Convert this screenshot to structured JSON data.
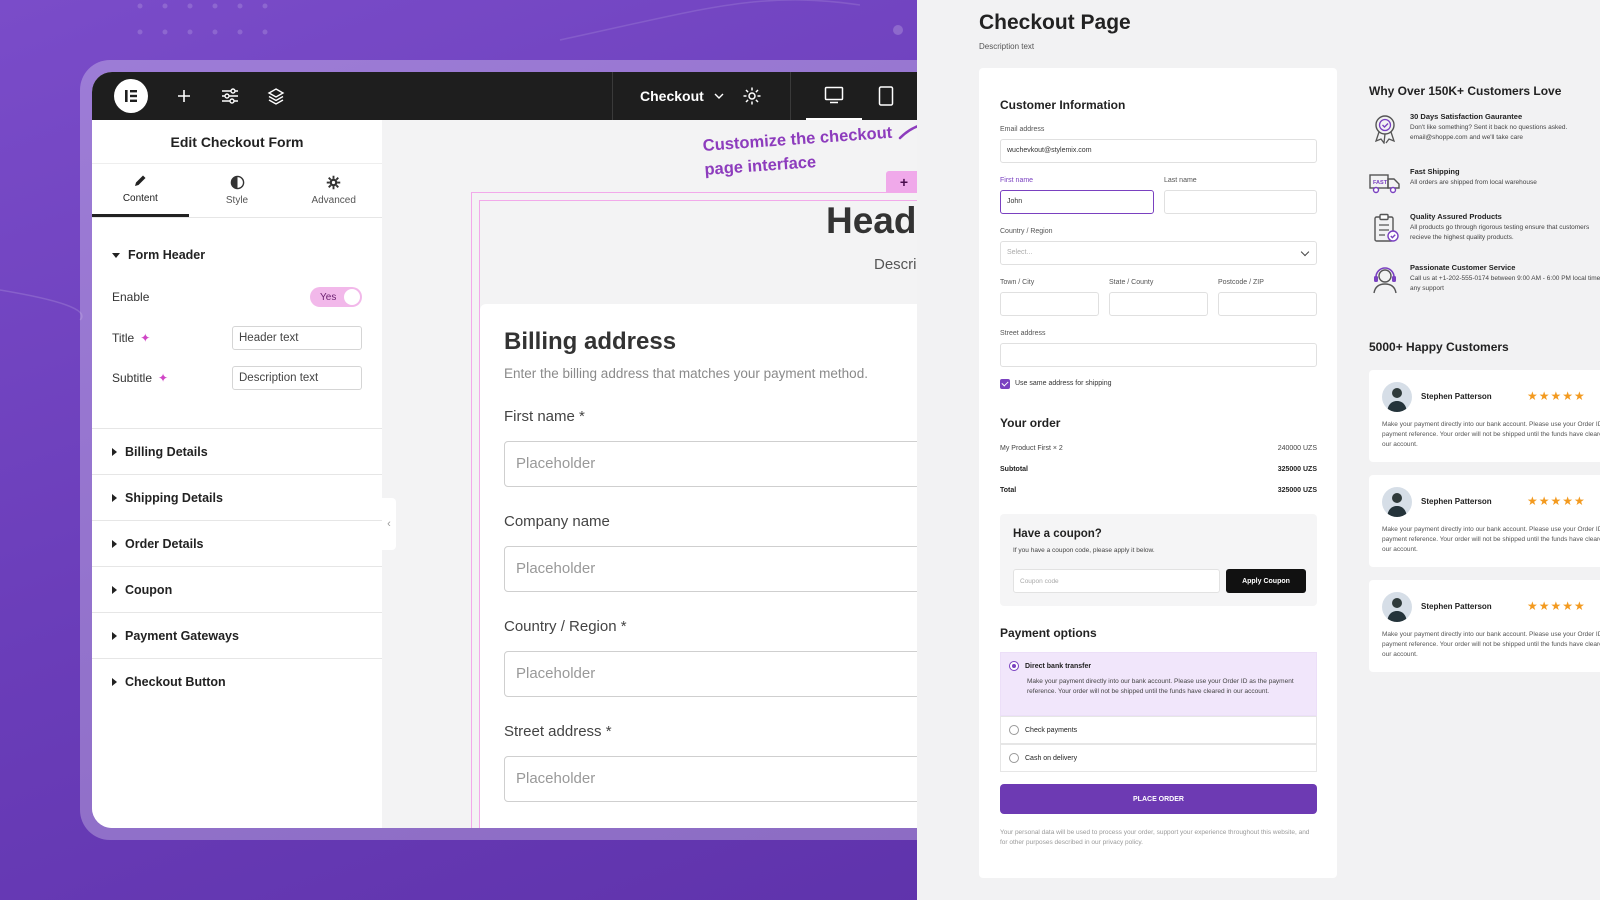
{
  "editor": {
    "toolbar": {
      "page_name": "Checkout"
    },
    "panel": {
      "title": "Edit Checkout Form",
      "tabs": [
        {
          "label": "Content",
          "icon": "pencil-icon"
        },
        {
          "label": "Style",
          "icon": "half-circle-icon"
        },
        {
          "label": "Advanced",
          "icon": "gear-icon"
        }
      ],
      "form_header": {
        "label": "Form Header",
        "enable_label": "Enable",
        "enable_value": "Yes",
        "title_label": "Title",
        "title_value": "Header text",
        "subtitle_label": "Subtitle",
        "subtitle_value": "Description text"
      },
      "sections": [
        "Billing Details",
        "Shipping Details",
        "Order Details",
        "Coupon",
        "Payment Gateways",
        "Checkout Button"
      ]
    },
    "canvas": {
      "callout_line1": "Customize the checkout",
      "callout_line2": "page interface",
      "plus": "+",
      "header_text": "Head",
      "desc_text": "Descri",
      "billing": {
        "title": "Billing address",
        "subtitle": "Enter the billing address that matches your payment method.",
        "fields": [
          {
            "label": "First name *",
            "placeholder": "Placeholder"
          },
          {
            "label": "Company name",
            "placeholder": "Placeholder"
          },
          {
            "label": "Country / Region *",
            "placeholder": "Placeholder"
          },
          {
            "label": "Street address *",
            "placeholder": "Placeholder"
          }
        ]
      }
    }
  },
  "checkout": {
    "title": "Checkout Page",
    "description": "Description text",
    "customer": {
      "heading": "Customer Information",
      "email_label": "Email address",
      "email_value": "wuchevkout@stylemix.com",
      "first_label": "First name",
      "first_value": "John",
      "last_label": "Last name",
      "country_label": "Country / Region",
      "country_placeholder": "Select...",
      "town_label": "Town / City",
      "state_label": "State / County",
      "postcode_label": "Postcode / ZIP",
      "street_label": "Street address",
      "same_address_label": "Use same address for shipping"
    },
    "order": {
      "heading": "Your order",
      "item_name": "My Product First  × 2",
      "item_price": "240000 UZS",
      "subtotal_label": "Subtotal",
      "subtotal_value": "325000 UZS",
      "total_label": "Total",
      "total_value": "325000 UZS"
    },
    "coupon": {
      "title": "Have a coupon?",
      "text": "If you have a coupon code, please apply it below.",
      "placeholder": "Coupon code",
      "button": "Apply Coupon"
    },
    "payment": {
      "heading": "Payment options",
      "options": [
        {
          "label": "Direct bank transfer",
          "selected": true,
          "description": "Make your payment directly into our bank account. Please use your Order ID as the payment reference. Your order will not be shipped until the funds have cleared in our account."
        },
        {
          "label": "Check payments",
          "selected": false
        },
        {
          "label": "Cash on delivery",
          "selected": false
        }
      ],
      "place_order": "PLACE ORDER",
      "privacy": "Your personal data will be used to process your order, support your experience throughout this website, and for other purposes described in our privacy policy."
    },
    "why": {
      "heading": "Why Over 150K+ Customers Love",
      "features": [
        {
          "title": "30 Days Satisfaction Gaurantee",
          "text": "Don't like something? Sent it back no questions asked. email@shoppe.com and we'll take care",
          "icon": "badge-icon"
        },
        {
          "title": "Fast Shipping",
          "text": "All orders are shipped from local warehouse",
          "icon": "truck-icon"
        },
        {
          "title": "Quality Assured Products",
          "text": "All products go through rigorous testing ensure that customers recieve the highest quality products.",
          "icon": "clipboard-icon"
        },
        {
          "title": "Passionate Customer Service",
          "text": "Call us at +1-202-555-0174 between 9:00 AM - 6:00 PM local time for any support",
          "icon": "headset-icon"
        }
      ]
    },
    "reviews": {
      "heading": "5000+ Happy Customers",
      "items": [
        {
          "name": "Stephen Patterson",
          "stars": "★★★★★",
          "text": "Make your payment directly into our bank account. Please use your Order ID as the payment reference. Your order will not be shipped until the funds have cleared in our account."
        },
        {
          "name": "Stephen Patterson",
          "stars": "★★★★★",
          "text": "Make your payment directly into our bank account. Please use your Order ID as the payment reference. Your order will not be shipped until the funds have cleared in our account."
        },
        {
          "name": "Stephen Patterson",
          "stars": "★★★★★",
          "text": "Make your payment directly into our bank account. Please use your Order ID as the payment reference. Your order will not be shipped until the funds have cleared in our account."
        }
      ]
    }
  },
  "colors": {
    "background": "#6a3db9",
    "accent_purple": "#6d3ab3",
    "highlight_pink": "#f2a9ea",
    "toolbar": "#1e1e1e",
    "star": "#f39a1f"
  }
}
